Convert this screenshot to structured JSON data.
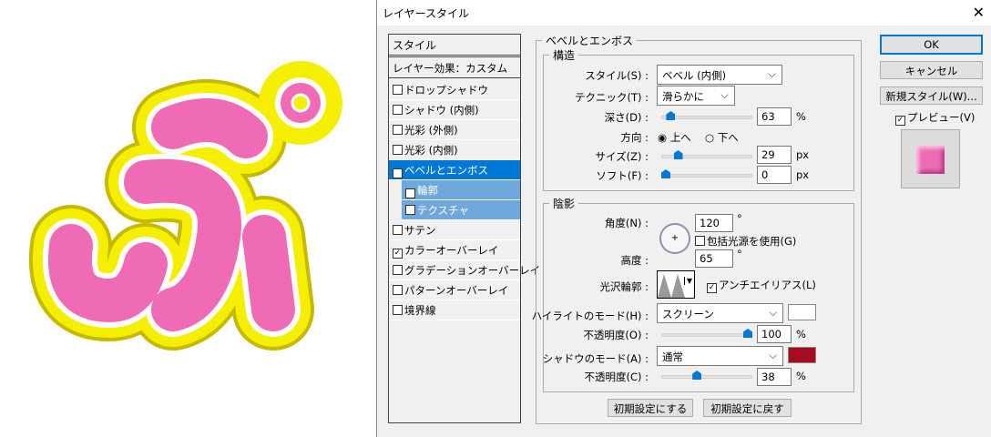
{
  "artwork": {
    "text": "ぷ",
    "colors": {
      "fill": "#f06bb5",
      "outline": "#f4ef00",
      "white": "#ffffff"
    }
  },
  "dialog": {
    "title": "レイヤースタイル",
    "close": "✕"
  },
  "list": {
    "header": "スタイル",
    "effects_label": "レイヤー効果：カスタム",
    "items": [
      {
        "label": "ドロップシャドウ",
        "checked": false
      },
      {
        "label": "シャドウ (内側)",
        "checked": false
      },
      {
        "label": "光彩 (外側)",
        "checked": false
      },
      {
        "label": "光彩 (内側)",
        "checked": false
      },
      {
        "label": "ベベルとエンボス",
        "checked": true,
        "selected": true
      },
      {
        "label": "輪郭",
        "checked": true,
        "sub": true
      },
      {
        "label": "テクスチャ",
        "checked": false,
        "sub": true
      },
      {
        "label": "サテン",
        "checked": false
      },
      {
        "label": "カラーオーバーレイ",
        "checked": true
      },
      {
        "label": "グラデーションオーバーレイ",
        "checked": false
      },
      {
        "label": "パターンオーバーレイ",
        "checked": false
      },
      {
        "label": "境界線",
        "checked": false
      }
    ]
  },
  "bevel": {
    "title": "ベベルとエンボス",
    "structure": {
      "title": "構造",
      "style_label": "スタイル(S) :",
      "style_value": "ベベル (内側)",
      "technique_label": "テクニック(T) :",
      "technique_value": "滑らかに",
      "depth_label": "深さ(D) :",
      "depth": "63",
      "depth_unit": "%",
      "direction_label": "方向 :",
      "dir_up": "上へ",
      "dir_down": "下へ",
      "size_label": "サイズ(Z) :",
      "size": "29",
      "size_unit": "px",
      "soften_label": "ソフト(F) :",
      "soften": "0",
      "soften_unit": "px"
    },
    "shading": {
      "title": "陰影",
      "angle_label": "角度(N) :",
      "angle": "120",
      "deg": "°",
      "global_light": "包括光源を使用(G)",
      "altitude_label": "高度 :",
      "altitude": "65",
      "gloss_label": "光沢輪郭 :",
      "antialias": "アンチエイリアス(L)",
      "highlight_label": "ハイライトのモード(H) :",
      "highlight_mode": "スクリーン",
      "highlight_color": "#ffffff",
      "hl_opacity_label": "不透明度(O) :",
      "hl_opacity": "100",
      "shadow_label": "シャドウのモード(A) :",
      "shadow_mode": "通常",
      "shadow_color": "#a50b22",
      "sh_opacity_label": "不透明度(C) :",
      "sh_opacity": "38",
      "pct": "%"
    },
    "make_default": "初期設定にする",
    "reset_default": "初期設定に戻す"
  },
  "buttons": {
    "ok": "OK",
    "cancel": "キャンセル",
    "new_style": "新規スタイル(W)...",
    "preview": "プレビュー(V)"
  },
  "sliders": {
    "depth_pct": 6,
    "size_pct": 15,
    "soften_pct": 0,
    "hl_opacity_pct": 100,
    "sh_opacity_pct": 38
  }
}
